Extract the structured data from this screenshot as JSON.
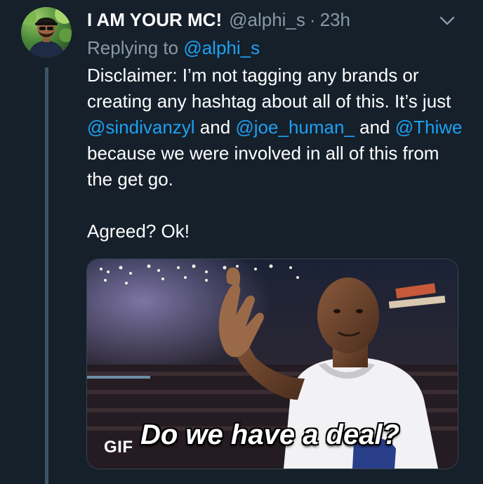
{
  "tweet": {
    "display_name": "I AM YOUR MC!",
    "handle": "@alphi_s",
    "separator": "·",
    "time": "23h",
    "replying_prefix": "Replying to",
    "replying_to": "@alphi_s",
    "body": {
      "line1_pre": "Disclaimer: I’m not tagging any brands or creating any hashtag about all of this. It’s just ",
      "mention1": "@sindivanzyl",
      "and1": " and ",
      "mention2": "@joe_human_",
      "and2": " and ",
      "mention3": "@Thiwe",
      "line1_post": " because we were involved in all of this from the get go.",
      "line2": "Agreed? Ok!"
    },
    "media": {
      "badge": "GIF",
      "caption": "Do we have a deal?"
    }
  },
  "icons": {
    "menu": "chevron-down-icon"
  },
  "colors": {
    "background": "#15202b",
    "mention": "#1da1f2",
    "muted": "#8899a6",
    "thread_line": "#3d5466"
  }
}
